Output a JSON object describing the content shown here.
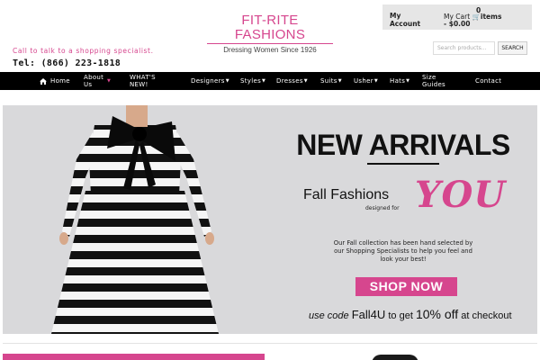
{
  "brand": {
    "title": "FIT-RITE FASHIONS",
    "tagline": "Dressing Women Since 1926"
  },
  "account": {
    "my_account": "My Account",
    "cart_count": "0",
    "cart_label": "My Cart",
    "cart_items": "items",
    "cart_total": "- $0.00"
  },
  "contact_bar": {
    "call_text": "Call to talk to a shopping specialist.",
    "phone": "Tel: (866) 223-1818"
  },
  "search": {
    "placeholder": "Search products...",
    "button": "SEARCH"
  },
  "nav": {
    "home": "Home",
    "about": "About Us",
    "whats_new": "WHAT'S NEW!",
    "designers": "Designers",
    "styles": "Styles",
    "dresses": "Dresses",
    "suits": "Suits",
    "usher": "Usher",
    "hats": "Hats",
    "size_guides": "Size Guides",
    "contact": "Contact"
  },
  "hero": {
    "headline": "NEW ARRIVALS",
    "sub_left": "Fall Fashions",
    "designed_for": "designed for",
    "you": "YOU",
    "collection_text": "Our Fall collection has been hand selected by our Shopping Specialists to help you feel and look your best!",
    "cta": "SHOP NOW",
    "promo_prefix": "use code",
    "promo_code": "Fall4U",
    "promo_middle": "to get",
    "promo_off": "10% off",
    "promo_suffix": "at checkout"
  },
  "colors": {
    "accent_pink": "#d6468e",
    "nav_bg": "#000000",
    "hero_bg": "#d9d9db"
  },
  "icons": [
    "home-icon",
    "cart-icon",
    "chevron-down-icon"
  ]
}
